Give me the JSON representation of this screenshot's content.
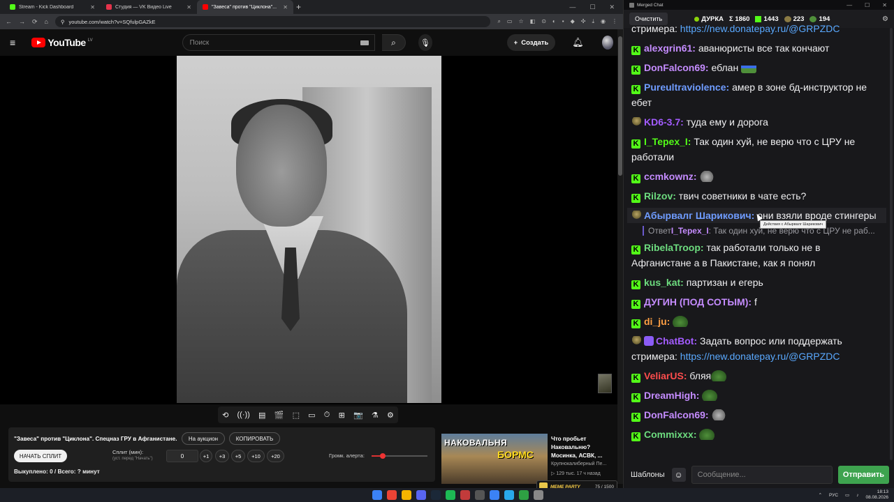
{
  "browser": {
    "tabs": [
      {
        "title": "Stream - Kick Dashboard",
        "favicon_color": "#53fc18",
        "active": false
      },
      {
        "title": "Студия — VK Видео Live",
        "favicon_color": "#e5334b",
        "active": false
      },
      {
        "title": "\"Завеса\" против \"Циклона\"...",
        "favicon_color": "#ff0000",
        "active": true
      }
    ],
    "url": "youtube.com/watch?v=SQfulpGAZkE",
    "window_controls": [
      "—",
      "☐",
      "✕"
    ]
  },
  "youtube": {
    "logo_text": "YouTube",
    "country_code": "LV",
    "search_placeholder": "Поиск",
    "create_label": "Создать",
    "player_controls": [
      "⟲",
      "((·))",
      "▤",
      "🎬",
      "⬚",
      "▭",
      "⏱",
      "⊞",
      "📷",
      "⚗",
      "⚙"
    ]
  },
  "panel": {
    "video_title": "\"Завеса\" против \"Циклона\". Спецназ ГРУ в Афганистане.",
    "auction_label": "На аукцион",
    "copy_label": "КОПИРОВАТЬ",
    "start_split_label": "НАЧАТЬ СПЛИТ",
    "split_label": "Сплит (мин):",
    "split_hint": "(уст. перед \"Начать\")",
    "split_value": "0",
    "increments": [
      "+1",
      "+3",
      "+5",
      "+10",
      "+20"
    ],
    "alert_volume_label": "Громк. алерта:",
    "alert_volume_level": 0.2,
    "bought_text": "Выкуплено: 0 / Всего: ? минут"
  },
  "recommendation": {
    "thumb_text_1": "НАКОВАЛЬНЯ",
    "thumb_text_2": "БОРМС",
    "title": "Что пробьет Наковальню? Мосинка, АСВК, ...",
    "channel": "Крупнокалиберный Пе...",
    "meta": "▷ 129 тыс.   17 ч назад"
  },
  "meme_widget": {
    "label": "MEME PARTY",
    "count": "75 / 1500"
  },
  "chat": {
    "window_title": "Merged Chat",
    "clear_label": "Очистить",
    "streamer": "ДУРКА",
    "stats": {
      "total": "Σ 1860",
      "kick": "1443",
      "vk": "223",
      "other": "194"
    },
    "tooltip": "Действия с Абырвалг Шарикович",
    "messages": [
      {
        "badge": "none",
        "user": "",
        "color": "#efeff1",
        "text": "стримера: ",
        "link": "https://new.donatepay.ru/@GRPZDC",
        "emote": ""
      },
      {
        "badge": "kick",
        "user": "alexgrin61",
        "color": "#c58cff",
        "text": "аванюристы все так кончают",
        "link": "",
        "emote": ""
      },
      {
        "badge": "kick",
        "user": "DonFalcon69",
        "color": "#c58cff",
        "text": "еблан ",
        "link": "",
        "emote": "hat"
      },
      {
        "badge": "kick",
        "user": "Pureultraviolence",
        "color": "#6f9cff",
        "text": "амер в зоне бд-инструктор не ебет",
        "link": "",
        "emote": ""
      },
      {
        "badge": "helm",
        "user": "KD6-3.7",
        "color": "#a35cff",
        "text": "туда ему и дорога",
        "link": "",
        "emote": ""
      },
      {
        "badge": "kick",
        "user": "I_Tepex_I",
        "color": "#53fc18",
        "text": "Так один хуй, не верю что с ЦРУ не работали",
        "link": "",
        "emote": ""
      },
      {
        "badge": "kick",
        "user": "ccmkownz",
        "color": "#c58cff",
        "text": "",
        "link": "",
        "emote": "cat"
      },
      {
        "badge": "kick",
        "user": "Rilzov",
        "color": "#6ddc7f",
        "text": "твич советники в чате есть?",
        "link": "",
        "emote": ""
      },
      {
        "badge": "helm",
        "user": "Абырвалг Шарикович",
        "color": "#6f9cff",
        "text": "они взяли вроде стингеры",
        "link": "",
        "emote": "",
        "reply_user": "I_Tepex_I",
        "reply_text": "Так один хуй, не верю что с ЦРУ не раб...",
        "reply_prefix": "Ответ"
      },
      {
        "badge": "kick",
        "user": "RibelaTroop",
        "color": "#6ddc7f",
        "text": "так работали только не в Афганистане а в Пакистане, как я понял",
        "link": "",
        "emote": ""
      },
      {
        "badge": "kick",
        "user": "kus_kat",
        "color": "#6ddc7f",
        "text": "партизан и егерь",
        "link": "",
        "emote": ""
      },
      {
        "badge": "kick",
        "user": "ДУГИН (ПОД СОТЫМ)",
        "color": "#c58cff",
        "text": "f",
        "link": "",
        "emote": ""
      },
      {
        "badge": "kick",
        "user": "di_ju",
        "color": "#ff9f43",
        "text": "",
        "link": "",
        "emote": "pepe"
      },
      {
        "badge": "bot",
        "user": "ChatBot",
        "color": "#a35cff",
        "text": "Задать вопрос или поддержать стримера: ",
        "link": "https://new.donatepay.ru/@GRPZDC",
        "emote": ""
      },
      {
        "badge": "kick",
        "user": "VeliarUS",
        "color": "#ff4d4d",
        "text": "бляя",
        "link": "",
        "emote": "pepe"
      },
      {
        "badge": "kick",
        "user": "DreamHigh",
        "color": "#c58cff",
        "text": "",
        "link": "",
        "emote": "pepe"
      },
      {
        "badge": "kick",
        "user": "DonFalcon69",
        "color": "#c58cff",
        "text": "",
        "link": "",
        "emote": "cat"
      },
      {
        "badge": "kick",
        "user": "Commixxx",
        "color": "#6ddc7f",
        "text": "",
        "link": "",
        "emote": "pepe"
      }
    ],
    "templates_label": "Шаблоны",
    "input_placeholder": "Сообщение...",
    "send_label": "Отправить"
  },
  "taskbar": {
    "icon_colors": [
      "#3b82f6",
      "#ea4335",
      "#f4b400",
      "#5865f2",
      "#1b2838",
      "#1db954",
      "#c23b3b",
      "#555",
      "#3b82f6",
      "#29a9eb",
      "#2ea043",
      "#888"
    ],
    "lang": "РУС",
    "time": "18:13",
    "date": "08.08.2026"
  }
}
